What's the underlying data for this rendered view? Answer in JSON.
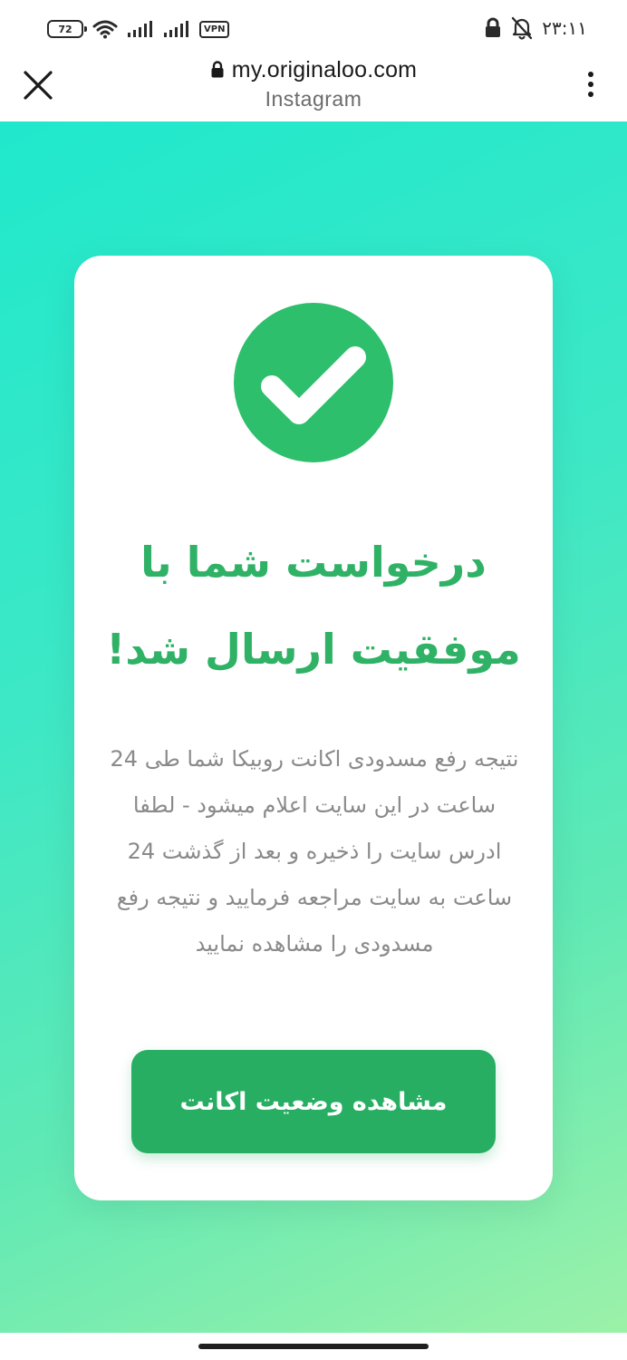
{
  "status_bar": {
    "battery_level": "72",
    "vpn_label": "VPN",
    "time": "۲۳:۱۱",
    "icons": [
      "battery-icon",
      "wifi-icon",
      "signal-icon",
      "signal-icon",
      "vpn-icon",
      "lock-icon",
      "bell-muted-icon"
    ]
  },
  "browser": {
    "url": "my.originaloo.com",
    "site_name": "Instagram",
    "icons": [
      "close-icon",
      "lock-icon",
      "more-vert-icon"
    ]
  },
  "success_card": {
    "icon": "check-circle-icon",
    "title": "درخواست شما با موفقیت ارسال شد!",
    "description": "نتیجه رفع مسدودی اکانت روبیکا شما طی 24 ساعت در این سایت اعلام میشود - لطفا ادرس سایت را ذخیره و بعد از گذشت 24 ساعت به سایت مراجعه فرمایید و نتیجه رفع مسدودی را مشاهده نمایید",
    "button_label": "مشاهده وضعیت اکانت"
  },
  "colors": {
    "accent_green": "#2dbf6b",
    "button_green": "#27ae63",
    "title_green": "#2fb166",
    "background_gradient_start": "#20e8cc",
    "background_gradient_end": "#9cf1a8"
  }
}
